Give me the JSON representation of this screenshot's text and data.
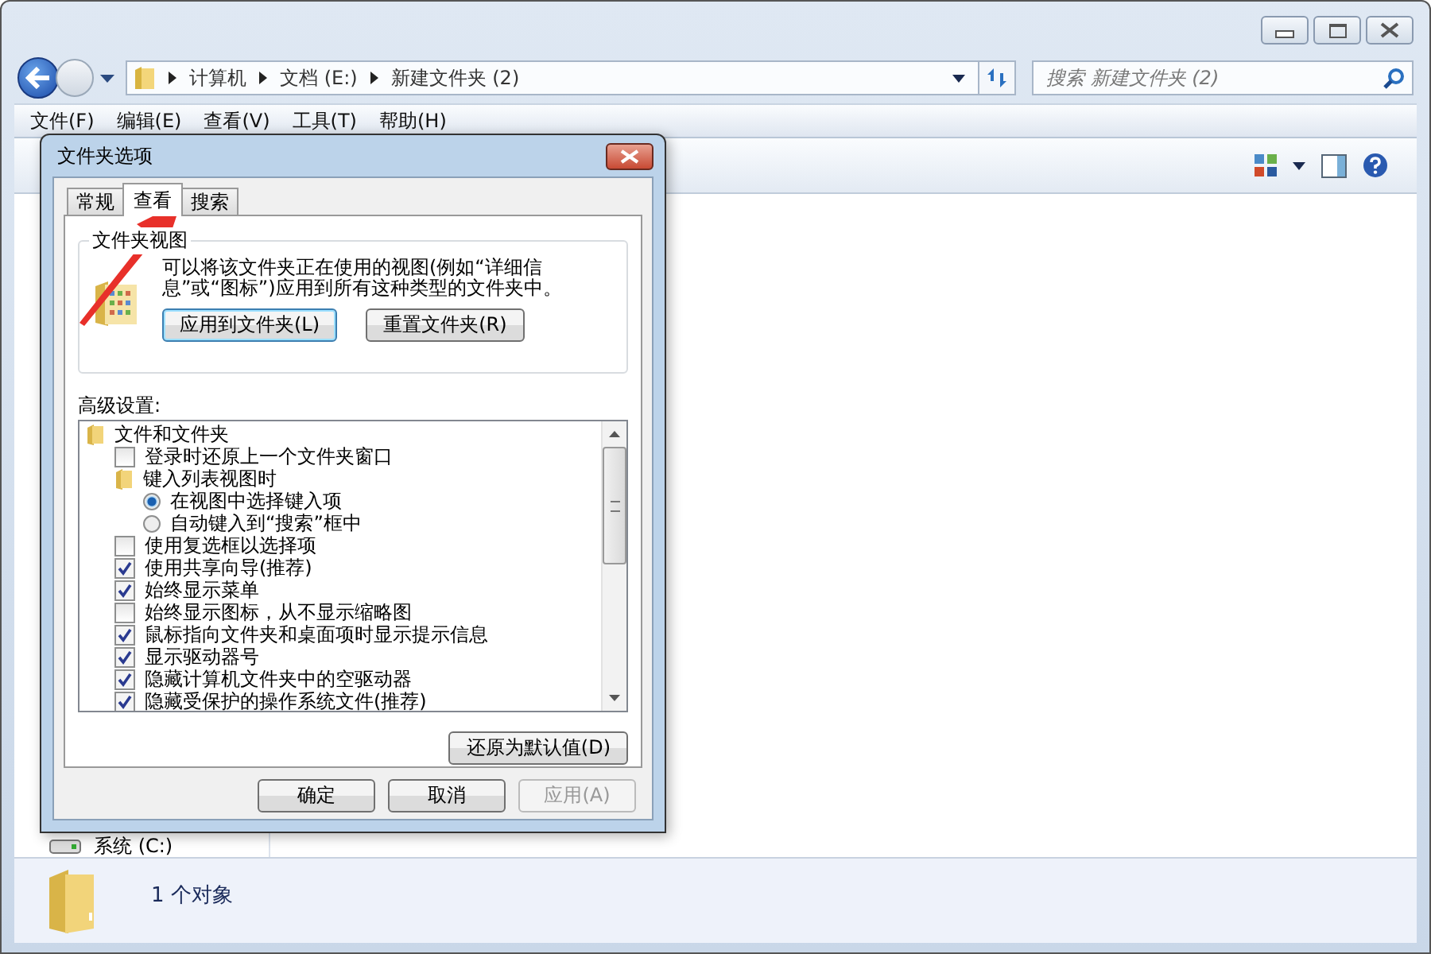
{
  "address_bar": {
    "crumbs": [
      "计算机",
      "文档 (E:)",
      "新建文件夹 (2)"
    ]
  },
  "search": {
    "placeholder": "搜索 新建文件夹 (2)"
  },
  "menu": [
    "文件(F)",
    "编辑(E)",
    "查看(V)",
    "工具(T)",
    "帮助(H)"
  ],
  "nav_pane": {
    "items": [
      "系统 (C:)"
    ]
  },
  "status_bar": {
    "text": "1 个对象"
  },
  "dialog": {
    "title": "文件夹选项",
    "tabs": [
      {
        "label": "常规",
        "selected": false
      },
      {
        "label": "查看",
        "selected": true
      },
      {
        "label": "搜索",
        "selected": false
      }
    ],
    "folder_views": {
      "title": "文件夹视图",
      "description": "可以将该文件夹正在使用的视图(例如“详细信息”或“图标”)应用到所有这种类型的文件夹中。",
      "buttons": [
        "应用到文件夹(L)",
        "重置文件夹(R)"
      ]
    },
    "advanced_label": "高级设置:",
    "tree": [
      {
        "kind": "folder",
        "label": "文件和文件夹",
        "children": [
          {
            "kind": "checkbox",
            "label": "登录时还原上一个文件夹窗口",
            "checked": false
          },
          {
            "kind": "folder",
            "label": "键入列表视图时",
            "children": [
              {
                "kind": "radio",
                "label": "在视图中选择键入项",
                "selected": true
              },
              {
                "kind": "radio",
                "label": "自动键入到“搜索”框中",
                "selected": false
              }
            ]
          },
          {
            "kind": "checkbox",
            "label": "使用复选框以选择项",
            "checked": false
          },
          {
            "kind": "checkbox",
            "label": "使用共享向导(推荐)",
            "checked": true
          },
          {
            "kind": "checkbox",
            "label": "始终显示菜单",
            "checked": true
          },
          {
            "kind": "checkbox",
            "label": "始终显示图标，从不显示缩略图",
            "checked": false
          },
          {
            "kind": "checkbox",
            "label": "鼠标指向文件夹和桌面项时显示提示信息",
            "checked": true
          },
          {
            "kind": "checkbox",
            "label": "显示驱动器号",
            "checked": true
          },
          {
            "kind": "checkbox",
            "label": "隐藏计算机文件夹中的空驱动器",
            "checked": true
          },
          {
            "kind": "checkbox",
            "label": "隐藏受保护的操作系统文件(推荐)",
            "checked": true
          }
        ]
      }
    ],
    "restore_button": "还原为默认值(D)",
    "buttons": [
      {
        "label": "确定",
        "disabled": false
      },
      {
        "label": "取消",
        "disabled": false
      },
      {
        "label": "应用(A)",
        "disabled": true
      }
    ]
  }
}
